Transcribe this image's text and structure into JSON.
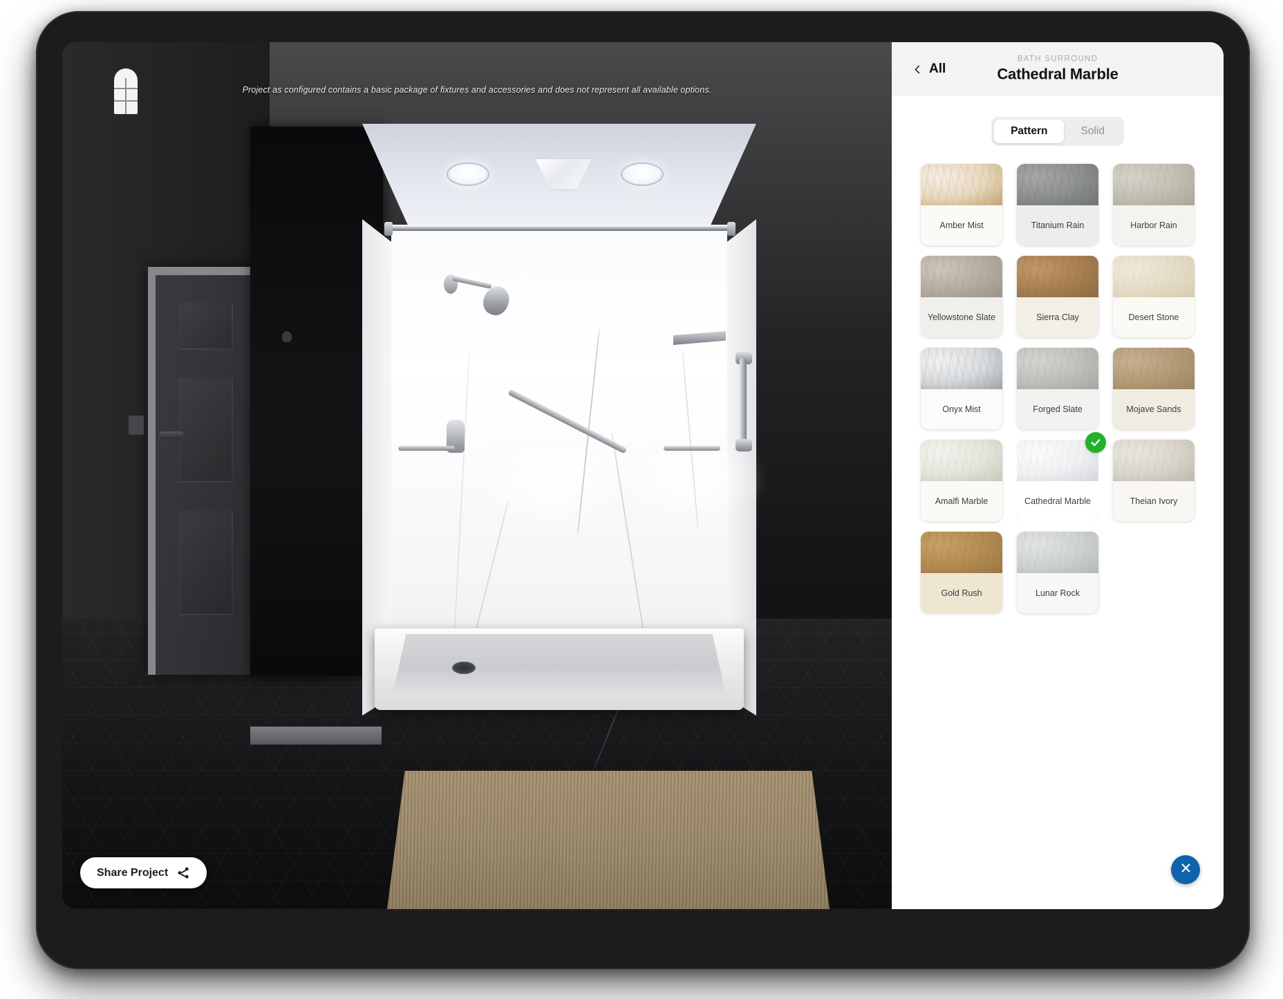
{
  "viewport": {
    "disclaimer": "Project as configured contains a basic package of fixtures and accessories and does not represent all available options.",
    "window_icon": "arched-window-icon",
    "share_button": {
      "label": "Share Project",
      "icon": "share-icon"
    }
  },
  "panel": {
    "back": {
      "label": "All",
      "icon": "chevron-left-icon"
    },
    "eyebrow": "BATH SURROUND",
    "title": "Cathedral Marble",
    "toggle": {
      "options": [
        "Pattern",
        "Solid"
      ],
      "selected": "Pattern"
    },
    "close_button": {
      "icon": "close-icon",
      "color": "#0f63ad"
    },
    "selected_color": "#22b22a",
    "swatches": [
      {
        "label": "Amber Mist",
        "c1": "#f6efe6",
        "c2": "#e8d9bf",
        "c3": "#c4a373",
        "cap": "#fbfaf7"
      },
      {
        "label": "Titanium Rain",
        "c1": "#a7a9a8",
        "c2": "#8d908f",
        "c3": "#6e7271",
        "cap": "#eceeee"
      },
      {
        "label": "Harbor Rain",
        "c1": "#d6d3c9",
        "c2": "#c3bfb3",
        "c3": "#aaa599",
        "cap": "#f4f3f0"
      },
      {
        "label": "Yellowstone Slate",
        "c1": "#cfc8bb",
        "c2": "#b5ada0",
        "c3": "#9b9386",
        "cap": "#f0efec"
      },
      {
        "label": "Sierra Clay",
        "c1": "#c29a6c",
        "c2": "#a87f52",
        "c3": "#8d6a43",
        "cap": "#f4efe6"
      },
      {
        "label": "Desert Stone",
        "c1": "#f0ead9",
        "c2": "#e4dcc7",
        "c3": "#d6ccb4",
        "cap": "#fbf9f3"
      },
      {
        "label": "Onyx Mist",
        "c1": "#f2f3f4",
        "c2": "#d9dbdd",
        "c3": "#9ea3a8",
        "cap": "#fbfbfc"
      },
      {
        "label": "Forged Slate",
        "c1": "#d5d6d2",
        "c2": "#bfc0bb",
        "c3": "#a4a6a1",
        "cap": "#f2f2f1"
      },
      {
        "label": "Mojave Sands",
        "c1": "#c8b290",
        "c2": "#b39b78",
        "c3": "#9c8462",
        "cap": "#f1ece1"
      },
      {
        "label": "Amalfi Marble",
        "c1": "#f4f3ee",
        "c2": "#e6e5dc",
        "c3": "#c8c7ba",
        "cap": "#fafaf7"
      },
      {
        "label": "Cathedral Marble",
        "c1": "#fcfcfd",
        "c2": "#f0f1f3",
        "c3": "#d3d6da",
        "cap": "#ffffff",
        "selected": true
      },
      {
        "label": "Theian Ivory",
        "c1": "#eae7e0",
        "c2": "#dad6cc",
        "c3": "#bdb8ac",
        "cap": "#f8f7f4"
      },
      {
        "label": "Gold Rush",
        "c1": "#c9a169",
        "c2": "#b38c53",
        "c3": "#9a7640",
        "cap": "#efe6d2"
      },
      {
        "label": "Lunar Rock",
        "c1": "#e3e5e5",
        "c2": "#cfd2d2",
        "c3": "#b3b7b7",
        "cap": "#f6f7f7"
      }
    ]
  }
}
